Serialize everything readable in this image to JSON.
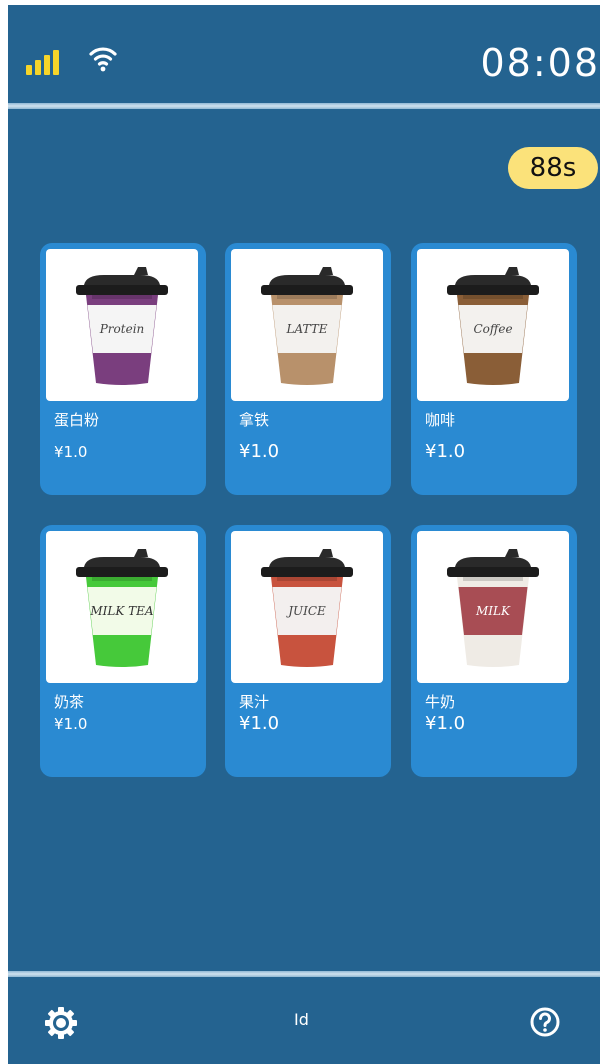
{
  "status": {
    "time": "08:08",
    "countdown": "88s",
    "signal_icon": "signal-bars-icon",
    "wifi_icon": "wifi-icon"
  },
  "products": [
    {
      "name": "蛋白粉",
      "price": "¥1.0",
      "cup_label": "Protein",
      "cup_color": "#7a3e7e",
      "band_color": "#f5f5f5",
      "text_color": "#444444"
    },
    {
      "name": "拿铁",
      "price": "¥1.0",
      "cup_label": "LATTE",
      "cup_color": "#b8916b",
      "band_color": "#f3f1ee",
      "text_color": "#444444"
    },
    {
      "name": "咖啡",
      "price": "¥1.0",
      "cup_label": "Coffee",
      "cup_color": "#8a5e37",
      "band_color": "#f3f1ee",
      "text_color": "#444444"
    },
    {
      "name": "奶茶",
      "price": "¥1.0",
      "cup_label": "MILK TEA",
      "cup_color": "#46c93a",
      "band_color": "#f2fbe8",
      "text_color": "#333333"
    },
    {
      "name": "果汁",
      "price": "¥1.0",
      "cup_label": "JUICE",
      "cup_color": "#c8533e",
      "band_color": "#f3efee",
      "text_color": "#444444"
    },
    {
      "name": "牛奶",
      "price": "¥1.0",
      "cup_label": "MILK",
      "cup_color": "#efebe5",
      "band_color": "#a84d54",
      "text_color": "#ffffff"
    }
  ],
  "footer": {
    "id_label": "Id",
    "settings_icon": "settings-gear-icon",
    "help_icon": "help-circle-icon"
  },
  "colors": {
    "background": "#246390",
    "card": "#2a8ad2",
    "badge": "#fbe27a",
    "signal": "#f7d52a"
  }
}
